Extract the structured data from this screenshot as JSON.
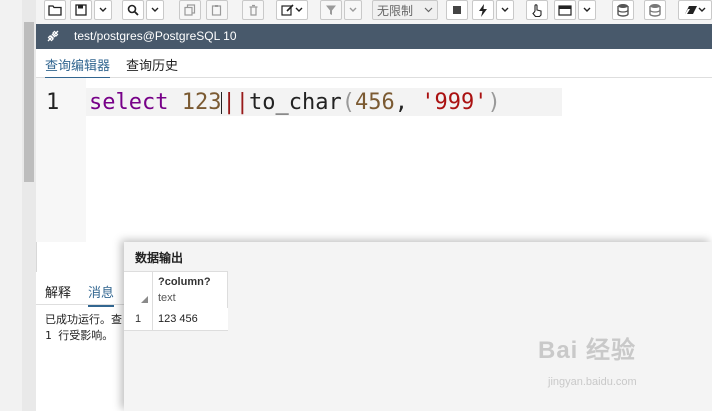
{
  "toolbar": {
    "limit_select_value": "无限制"
  },
  "editor_tab": {
    "title": "test/postgres@PostgreSQL 10"
  },
  "subtabs": {
    "query_editor": "查询编辑器",
    "query_history": "查询历史"
  },
  "editor": {
    "line_number": "1",
    "code": {
      "keyword": "select",
      "number1": "123",
      "operator": "||",
      "function": "to_char",
      "open_paren": "(",
      "number2": "456",
      "comma": ", ",
      "string": "'999'",
      "close_paren": ")"
    }
  },
  "messages_panel": {
    "tab_explain": "解释",
    "tab_messages": "消息",
    "line1": "已成功运行。查",
    "line2": "1 行受影响。"
  },
  "data_output": {
    "title": "数据输出",
    "columns": [
      {
        "name": "?column?",
        "type": "text"
      }
    ],
    "rows": [
      {
        "row_number": "1",
        "values": [
          "123 456"
        ]
      }
    ]
  },
  "watermark": {
    "text": "Bai 经验",
    "subtext": "jingyan.baidu.com"
  }
}
